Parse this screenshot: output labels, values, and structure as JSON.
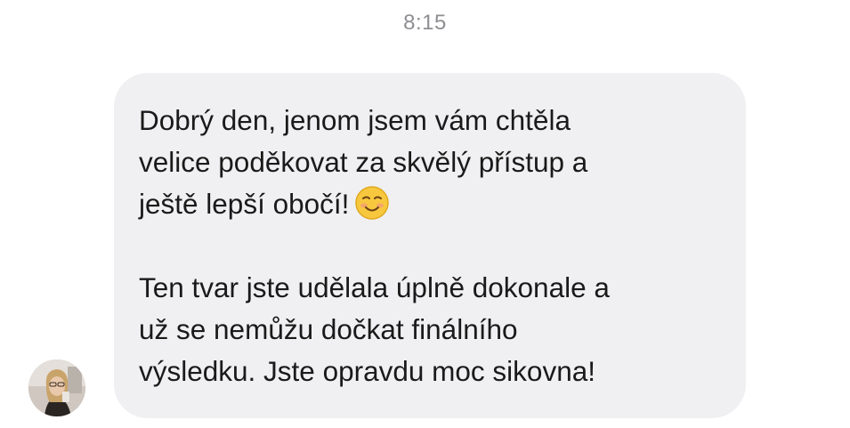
{
  "chat": {
    "timestamp": "8:15",
    "message": {
      "paragraph_1": "Dobrý den, jenom jsem vám chtěla\nvelice poděkovat za skvělý přístup a\nještě lepší obočí!",
      "paragraph_1_emoji": "smiling-face-with-smiling-eyes",
      "paragraph_2": "Ten tvar jste udělala úplně dokonale a\nuž se nemůžu dočkat finálního\nvýsledku. Jste opravdu moc sikovna!"
    },
    "bubble_color": "#f0f0f2",
    "timestamp_color": "#8e8e93"
  }
}
